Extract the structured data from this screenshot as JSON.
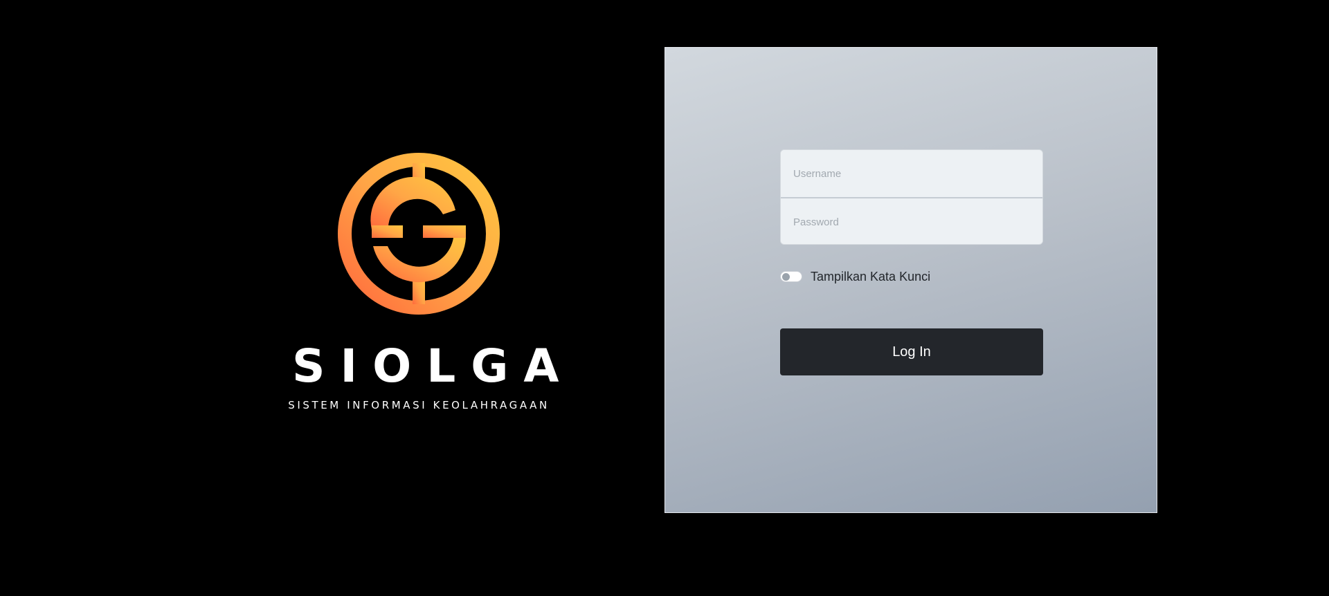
{
  "brand": {
    "title": "SIOLGA",
    "subtitle": "SISTEM INFORMASI KEOLAHRAGAAN",
    "logo_icon": "siolga-circle-s-logo-icon",
    "logo_gradient": [
      "#ff6a3d",
      "#ffa646",
      "#ffc640"
    ]
  },
  "login_form": {
    "username_placeholder": "Username",
    "username_value": "",
    "password_placeholder": "Password",
    "password_value": "",
    "show_password_label": "Tampilkan Kata Kunci",
    "show_password_checked": false,
    "submit_label": "Log In"
  },
  "colors": {
    "page_background": "#000000",
    "button_background": "#23262b",
    "panel_gradient": [
      "#d2d8de",
      "#94a0b0"
    ]
  }
}
